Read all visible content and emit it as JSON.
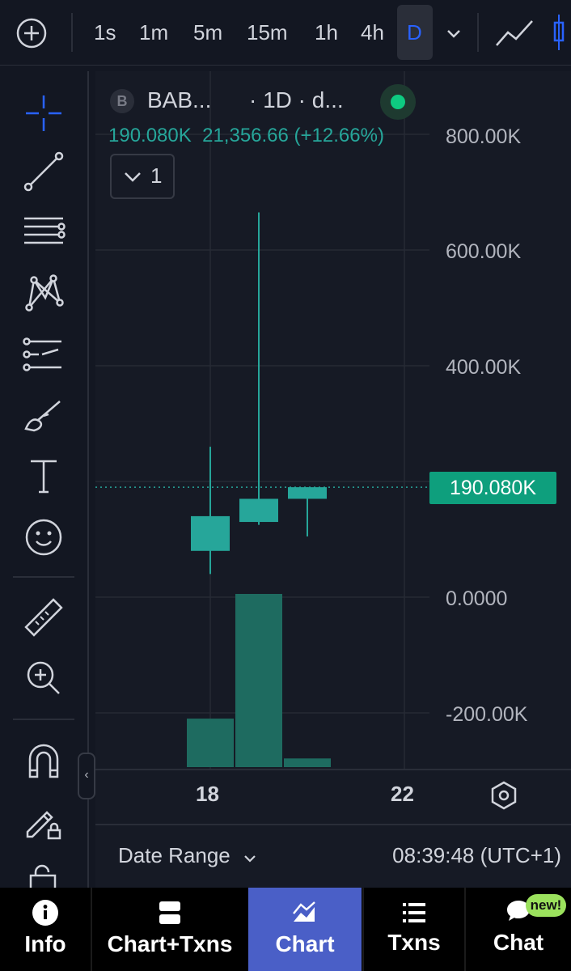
{
  "toolbar": {
    "timeframes": [
      "1s",
      "1m",
      "5m",
      "15m",
      "1h",
      "4h",
      "D"
    ],
    "active_timeframe": "D"
  },
  "legend": {
    "badge": "B",
    "symbol": "BAB...",
    "interval": "· 1D · d...",
    "last_value": "190.080K",
    "change": "21,356.66 (+12.66%)",
    "indicators_count": "1"
  },
  "price_axis": {
    "labels": [
      "800.00K",
      "600.00K",
      "400.00K",
      "0.0000",
      "-200.00K"
    ],
    "current_price": "190.080K"
  },
  "time_axis": {
    "labels": [
      "18",
      "22"
    ]
  },
  "footer": {
    "date_range": "Date Range",
    "clock": "08:39:48 (UTC+1)"
  },
  "nav": {
    "tabs": [
      "Info",
      "Chart+Txns",
      "Chart",
      "Txns",
      "Chat"
    ],
    "active": "Chart",
    "new_badge": "new!"
  },
  "colors": {
    "up": "#26a69a",
    "volume": "#1e6b60",
    "accent": "#2962ff",
    "active_tab": "#4a5fc7"
  },
  "chart_data": {
    "type": "candlestick",
    "candles": [
      {
        "open": 80000,
        "high": 260000,
        "low": 40000,
        "close": 140000
      },
      {
        "open": 130000,
        "high": 665000,
        "low": 125000,
        "close": 170000
      },
      {
        "open": 170000,
        "high": 190000,
        "low": 105000,
        "close": 190080
      }
    ],
    "volume": [
      0.28,
      1.0,
      0.05
    ],
    "ylim": [
      -240000,
      900000
    ]
  }
}
